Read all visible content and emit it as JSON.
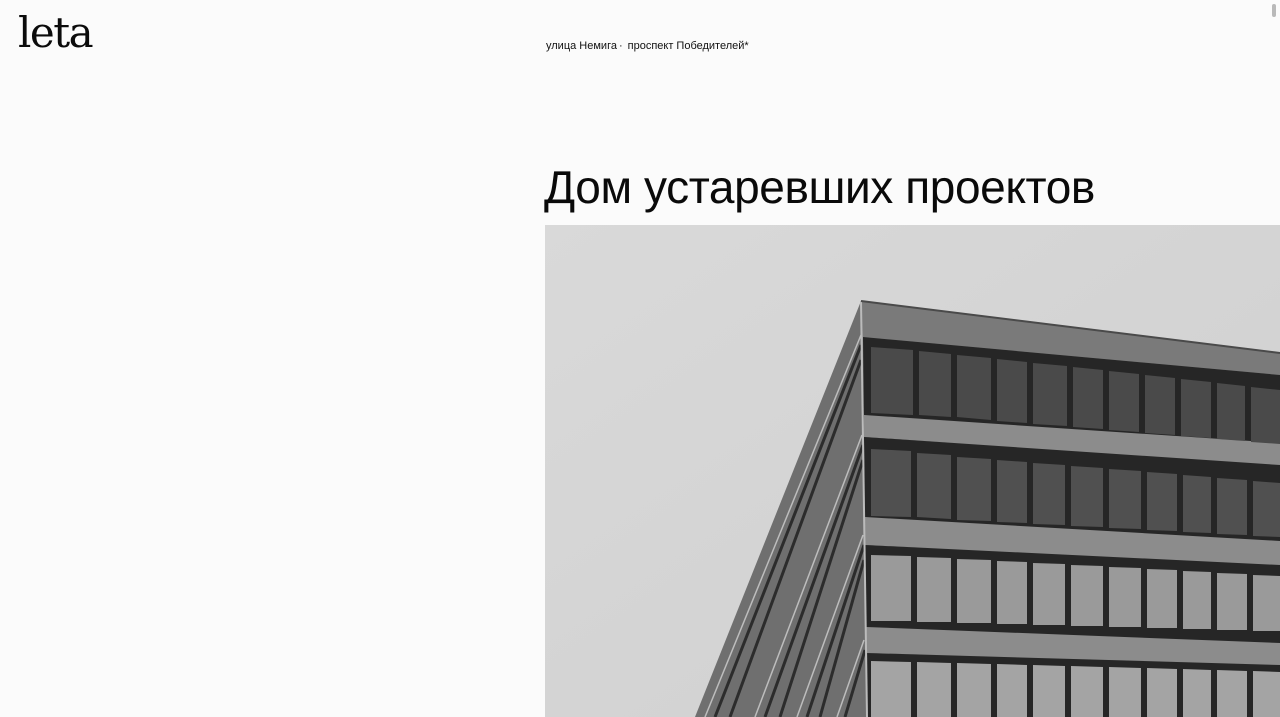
{
  "header": {
    "logo_text": "leta"
  },
  "breadcrumbs": [
    {
      "label": "улица Немига",
      "separator": "·"
    },
    {
      "label": "проспект Победителей*"
    }
  ],
  "article": {
    "title": "Дом устаревших проектов",
    "photo_icon": "building-photo"
  },
  "colors": {
    "background": "#fbfbfb",
    "text": "#0a0a0a",
    "sky": "#d6d6d6",
    "facade": "#7d7d7d",
    "window": "#3a3a3a"
  }
}
